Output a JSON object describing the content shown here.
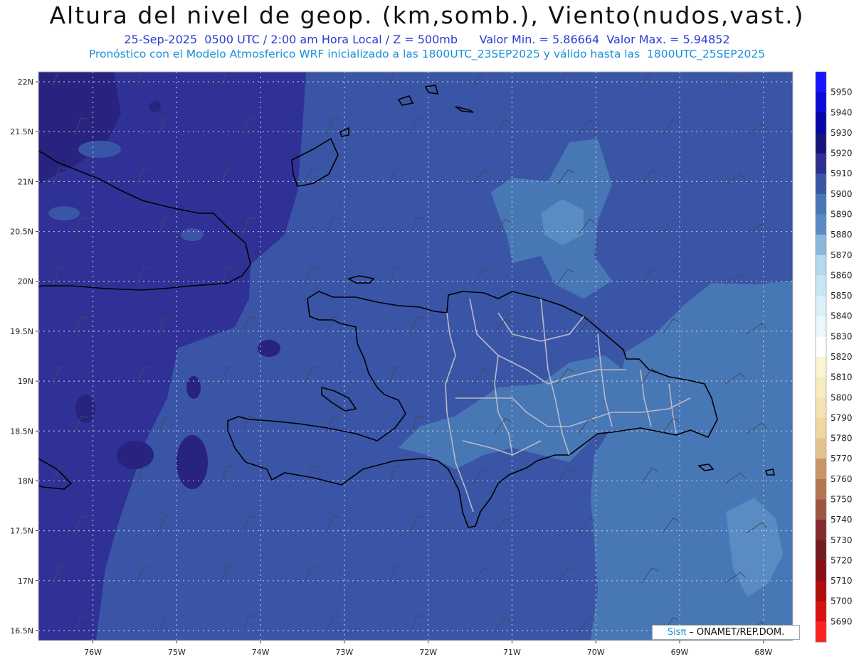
{
  "header": {
    "title": "Altura del nivel de geop. (km,somb.), Viento(nudos,vast.)",
    "date_line": "25-Sep-2025  0500 UTC / 2:00 am Hora Local / Z = 500mb",
    "min_label": "Valor Min. = 5.86664",
    "max_label": "Valor Max. = 5.94852",
    "forecast_line": "Pronóstico con el Modelo Atmosferico WRF inicializado a las 1800UTC_23SEP2025 y válido hasta las  1800UTC_25SEP2025"
  },
  "map": {
    "lat_labels": [
      "22N",
      "21.5N",
      "21N",
      "20.5N",
      "20N",
      "19.5N",
      "19N",
      "18.5N",
      "18N",
      "17.5N",
      "17N",
      "16.5N"
    ],
    "lon_labels": [
      "76W",
      "75W",
      "74W",
      "73W",
      "72W",
      "71W",
      "70W",
      "69W",
      "68W"
    ],
    "lat_range": [
      16.4,
      22.1
    ],
    "lon_range": [
      -76.65,
      -67.65
    ],
    "grid": "dotted",
    "zones": [
      {
        "name": "5920-5930",
        "color": "#27237e"
      },
      {
        "name": "5910-5920",
        "color": "#2f3196"
      },
      {
        "name": "5900-5910",
        "color": "#3a55a6"
      },
      {
        "name": "5890-5900",
        "color": "#4877b6"
      },
      {
        "name": "5880-5890",
        "color": "#5a8cc3"
      }
    ]
  },
  "colorbar": {
    "levels": [
      "5950",
      "5940",
      "5930",
      "5920",
      "5910",
      "5900",
      "5890",
      "5880",
      "5870",
      "5860",
      "5850",
      "5840",
      "5830",
      "5820",
      "5810",
      "5800",
      "5790",
      "5780",
      "5770",
      "5760",
      "5750",
      "5740",
      "5730",
      "5720",
      "5710",
      "5700",
      "5690"
    ],
    "colors": [
      "#1515ff",
      "#0a0ad8",
      "#0606a8",
      "#15127a",
      "#2e2f92",
      "#3a55a6",
      "#4877b6",
      "#5a8cc3",
      "#8bb7dc",
      "#b2d9ee",
      "#c6e8f4",
      "#d8f0f8",
      "#e8f8fb",
      "#ffffff",
      "#fbf4d0",
      "#f7ecc0",
      "#f3e3b0",
      "#efd9a0",
      "#e3c290",
      "#c99668",
      "#b57550",
      "#9e5540",
      "#862a2e",
      "#741a20",
      "#8a0f12",
      "#b00c0c",
      "#d81010",
      "#ff2020"
    ]
  },
  "credit": {
    "sis": "Sisπ",
    "text": "– ONAMET/REP.DOM."
  }
}
